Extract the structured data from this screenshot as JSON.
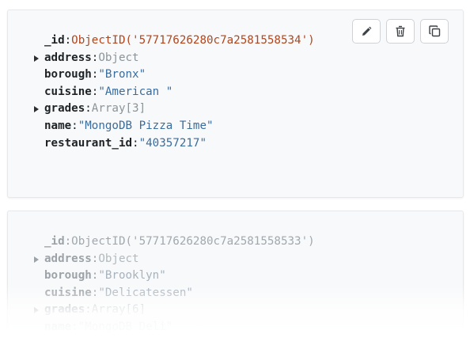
{
  "documents": [
    {
      "fields": [
        {
          "key": "_id",
          "value": "ObjectID('57717626280c7a2581558534')",
          "kind": "oid",
          "expandable": false
        },
        {
          "key": "address",
          "value": "Object",
          "kind": "type",
          "expandable": true
        },
        {
          "key": "borough",
          "value": "\"Bronx\"",
          "kind": "str",
          "expandable": false
        },
        {
          "key": "cuisine",
          "value": "\"American \"",
          "kind": "str",
          "expandable": false
        },
        {
          "key": "grades",
          "value": "Array[3]",
          "kind": "type",
          "expandable": true
        },
        {
          "key": "name",
          "value": "\"MongoDB Pizza Time\"",
          "kind": "str",
          "expandable": false
        },
        {
          "key": "restaurant_id",
          "value": "\"40357217\"",
          "kind": "str",
          "expandable": false
        }
      ],
      "actions": [
        {
          "name": "edit-document-button",
          "icon": "pencil-icon"
        },
        {
          "name": "delete-document-button",
          "icon": "trash-icon"
        },
        {
          "name": "clone-document-button",
          "icon": "copy-icon"
        }
      ]
    },
    {
      "fields": [
        {
          "key": "_id",
          "value": "ObjectID('57717626280c7a2581558533')",
          "kind": "oid",
          "expandable": false
        },
        {
          "key": "address",
          "value": "Object",
          "kind": "type",
          "expandable": true
        },
        {
          "key": "borough",
          "value": "\"Brooklyn\"",
          "kind": "str",
          "expandable": false
        },
        {
          "key": "cuisine",
          "value": "\"Delicatessen\"",
          "kind": "str",
          "expandable": false
        },
        {
          "key": "grades",
          "value": "Array[6]",
          "kind": "type",
          "expandable": true
        },
        {
          "key": "name",
          "value": "\"MongoDB Deli\"",
          "kind": "str",
          "expandable": false
        }
      ]
    }
  ],
  "colors": {
    "key": "#1f2326",
    "objectid": "#b1461d",
    "string": "#3b6c9c",
    "type": "#8d9499",
    "card_bg": "#f8f9fa"
  }
}
